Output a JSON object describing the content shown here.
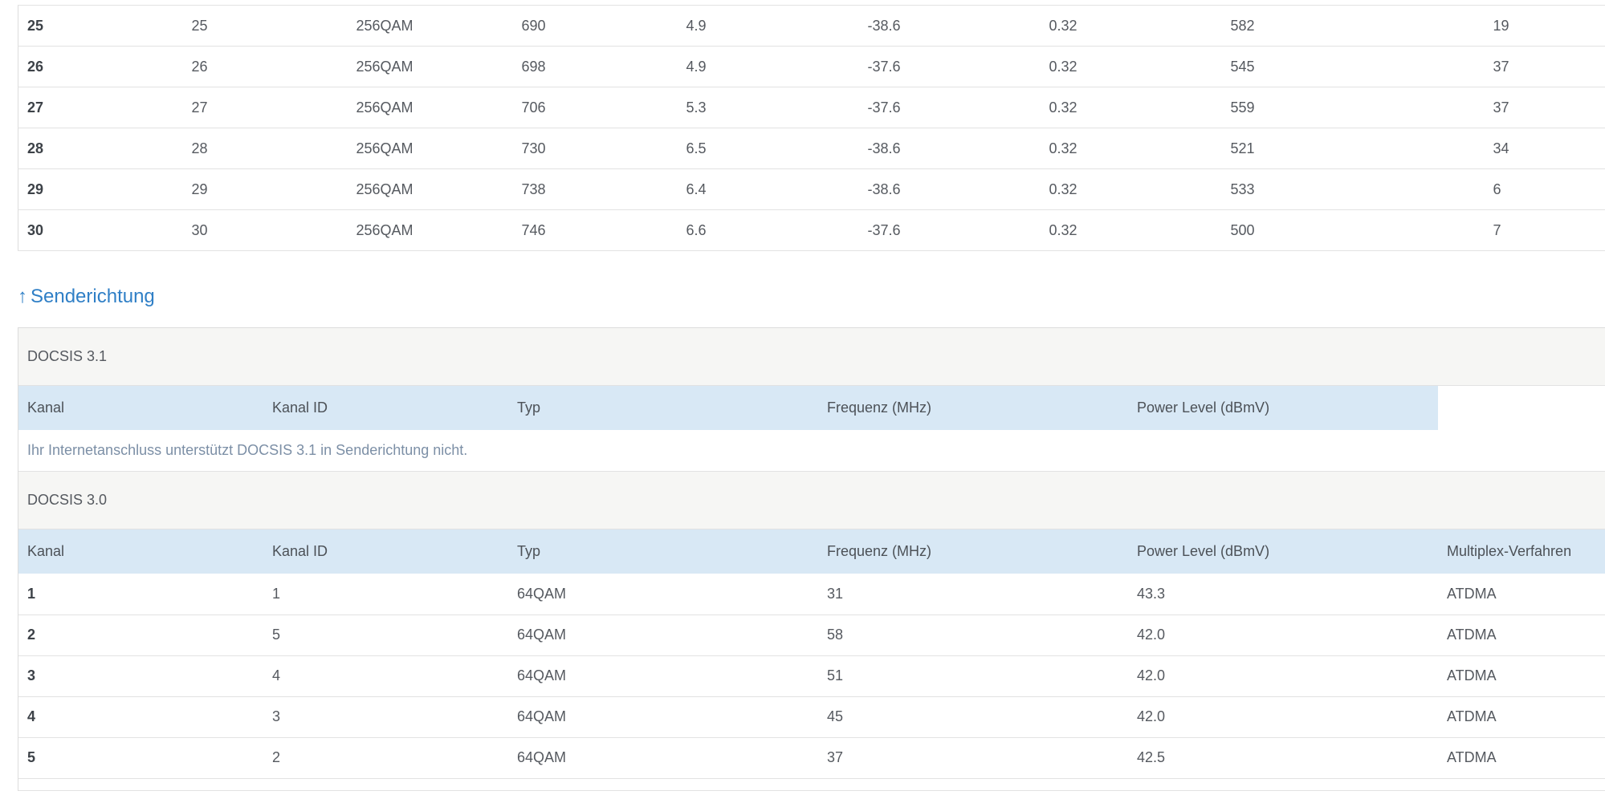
{
  "downstream": {
    "rows": [
      [
        "25",
        "25",
        "256QAM",
        "690",
        "4.9",
        "-38.6",
        "0.32",
        "582",
        "19"
      ],
      [
        "26",
        "26",
        "256QAM",
        "698",
        "4.9",
        "-37.6",
        "0.32",
        "545",
        "37"
      ],
      [
        "27",
        "27",
        "256QAM",
        "706",
        "5.3",
        "-37.6",
        "0.32",
        "559",
        "37"
      ],
      [
        "28",
        "28",
        "256QAM",
        "730",
        "6.5",
        "-38.6",
        "0.32",
        "521",
        "34"
      ],
      [
        "29",
        "29",
        "256QAM",
        "738",
        "6.4",
        "-38.6",
        "0.32",
        "533",
        "6"
      ],
      [
        "30",
        "30",
        "256QAM",
        "746",
        "6.6",
        "-37.6",
        "0.32",
        "500",
        "7"
      ]
    ]
  },
  "upstream": {
    "arrow": "↑",
    "title": "Senderichtung",
    "docsis31": {
      "title": "DOCSIS 3.1",
      "headers": [
        "Kanal",
        "Kanal ID",
        "Typ",
        "Frequenz (MHz)",
        "Power Level (dBmV)"
      ],
      "notice": "Ihr Internetanschluss unterstützt DOCSIS 3.1 in Senderichtung nicht."
    },
    "docsis30": {
      "title": "DOCSIS 3.0",
      "headers": [
        "Kanal",
        "Kanal ID",
        "Typ",
        "Frequenz (MHz)",
        "Power Level (dBmV)",
        "Multiplex-Verfahren"
      ],
      "rows": [
        [
          "1",
          "1",
          "64QAM",
          "31",
          "43.3",
          "ATDMA"
        ],
        [
          "2",
          "5",
          "64QAM",
          "58",
          "42.0",
          "ATDMA"
        ],
        [
          "3",
          "4",
          "64QAM",
          "51",
          "42.0",
          "ATDMA"
        ],
        [
          "4",
          "3",
          "64QAM",
          "45",
          "42.0",
          "ATDMA"
        ],
        [
          "5",
          "2",
          "64QAM",
          "37",
          "42.5",
          "ATDMA"
        ]
      ]
    }
  }
}
